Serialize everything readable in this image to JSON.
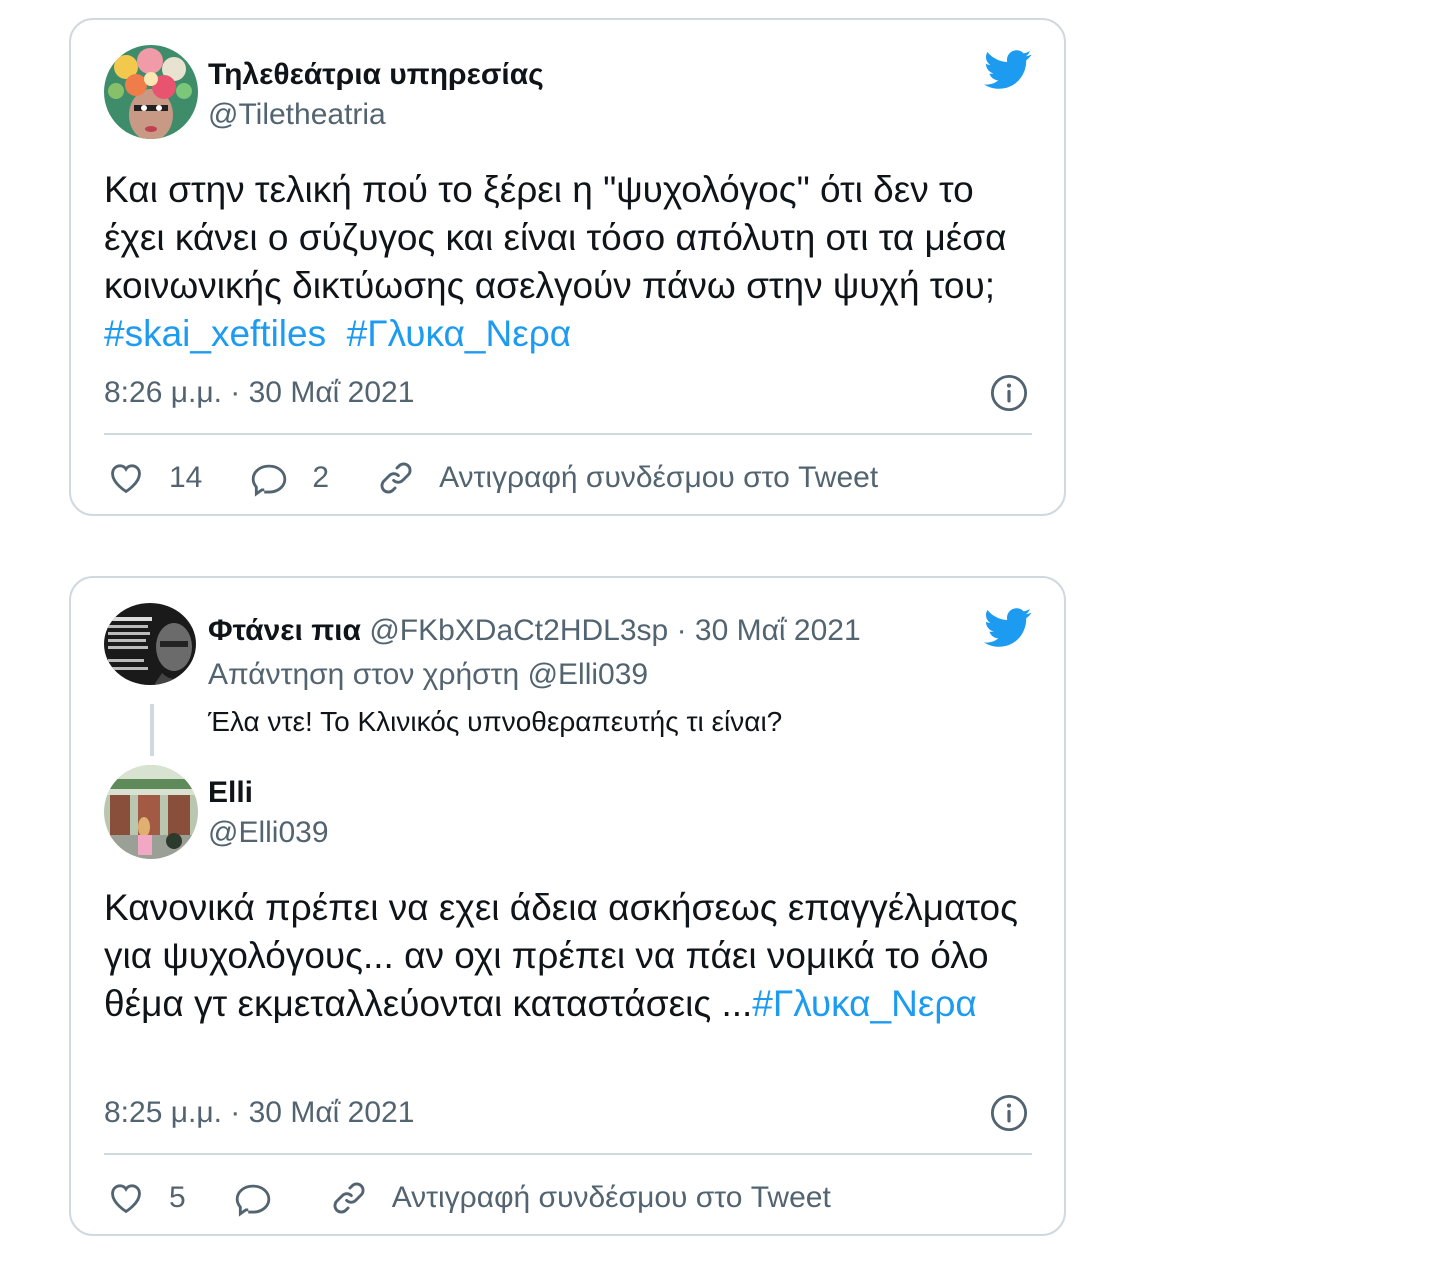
{
  "tweets": [
    {
      "author_name": "Τηλεθεάτρια υπηρεσίας",
      "author_handle": "@Tiletheatria",
      "text_before": "Και στην τελική πού το ξέρει η \"ψυχολόγος\" ότι δεν το έχει κάνει ο σύζυγος και είναι τόσο απόλυτη οτι τα μέσα κοινωνικής δικτύωσης ασελγούν πάνω στην ψυχή του; ",
      "hashtag1": "#skai_xeftiles",
      "hashtag2": "#Γλυκα_Νερα",
      "timestamp": "8:26 μ.μ. · 30 Μαΐ 2021",
      "likes": "14",
      "replies": "2",
      "copy_link_label": "Αντιγραφή συνδέσμου στο Tweet",
      "icons": [
        "avatar-flowers",
        "twitter-bird-icon",
        "info-icon",
        "heart-icon",
        "reply-icon",
        "link-icon"
      ]
    },
    {
      "parent": {
        "author_name": "Φτάνει πια",
        "author_handle": "@FKbXDaCt2HDL3sp",
        "date": "· 30 Μαΐ 2021",
        "reply_prefix": "Απάντηση στον χρήστη",
        "reply_mention": "@Elli039",
        "text": "Έλα ντε! Το Κλινικός υπνοθεραπευτής τι είναι?"
      },
      "author_name": "Elli",
      "author_handle": "@Elli039",
      "text_before": "Κανονικά πρέπει να εχει άδεια ασκήσεως επαγγέλματος για ψυχολόγους... αν οχι πρέπει να πάει νομικά το όλο θέμα γτ εκμεταλλεύονται καταστάσεις ...",
      "hashtag1": "#Γλυκα_Νερα",
      "timestamp": "8:25 μ.μ. · 30 Μαΐ 2021",
      "likes": "5",
      "copy_link_label": "Αντιγραφή συνδέσμου στο Tweet",
      "icons": [
        "avatar-malcolm",
        "avatar-street",
        "twitter-bird-icon",
        "info-icon",
        "heart-icon",
        "reply-icon",
        "link-icon"
      ]
    }
  ],
  "colors": {
    "link": "#1d9bf0",
    "muted": "#536471",
    "border": "#cfd9de",
    "text": "#0f1419"
  }
}
